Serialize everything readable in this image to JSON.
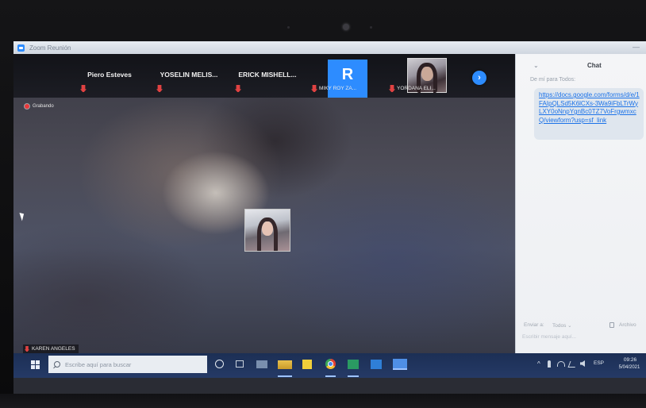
{
  "window": {
    "title": "Zoom Reunión"
  },
  "gallery": {
    "participants": [
      {
        "name": "Piero Esteves"
      },
      {
        "name": "YOSELIN MELIS..."
      },
      {
        "name": "ERICK MISHELL..."
      },
      {
        "name": "MIKY ROY ZA...",
        "avatar_letter": "R"
      },
      {
        "name": "YORDANA ELI..."
      }
    ]
  },
  "meeting": {
    "recording_label": "Grabando",
    "active_speaker": "KAREN ANGELES"
  },
  "chat": {
    "title": "Chat",
    "from_label": "De mí para Todos:",
    "message_link": "https://docs.google.com/forms/d/e/1FAIpQLSd5K6lCXs-3Wa9iFbLTrWyLXY0oNnpYgnBc0TZ7VoFrgwmxcQ/viewform?usp=sf_link",
    "send_to_label": "Enviar a:",
    "send_to_value": "Todos ⌄",
    "file_label": "Archivo",
    "input_placeholder": "Escribir mensaje aquí..."
  },
  "taskbar": {
    "search_placeholder": "Escribe aquí para buscar",
    "language": "ESP",
    "time": "09:26",
    "date": "5/04/2021"
  },
  "colors": {
    "zoom_blue": "#2d8cff",
    "mute_red": "#e04242",
    "taskbar": "#1c2f55",
    "chat_link": "#1b72e8"
  }
}
